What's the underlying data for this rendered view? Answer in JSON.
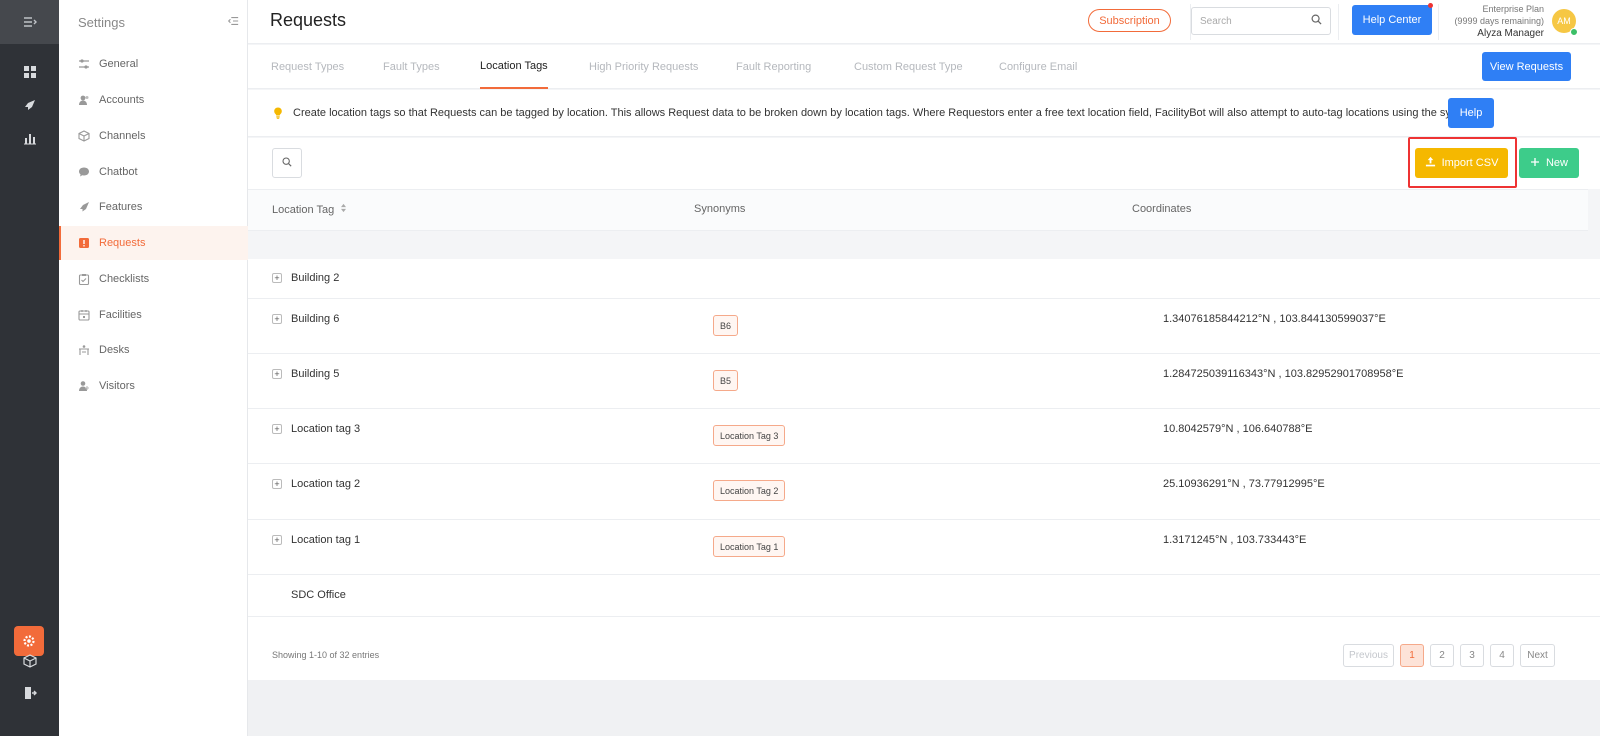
{
  "rail": {
    "items": [
      "dashboard-icon",
      "requests-rocket-icon",
      "analytics-icon",
      "settings-gear-icon",
      "cube-icon",
      "logout-icon"
    ]
  },
  "sidebar": {
    "title": "Settings",
    "items": [
      {
        "label": "General",
        "icon": "sliders-icon"
      },
      {
        "label": "Accounts",
        "icon": "users-icon"
      },
      {
        "label": "Channels",
        "icon": "cube-icon"
      },
      {
        "label": "Chatbot",
        "icon": "chat-icon"
      },
      {
        "label": "Features",
        "icon": "rocket-icon"
      },
      {
        "label": "Requests",
        "icon": "alert-box-icon",
        "active": true
      },
      {
        "label": "Checklists",
        "icon": "clipboard-icon"
      },
      {
        "label": "Facilities",
        "icon": "calendar-icon"
      },
      {
        "label": "Desks",
        "icon": "desk-icon"
      },
      {
        "label": "Visitors",
        "icon": "visitor-icon"
      }
    ]
  },
  "header": {
    "title": "Requests",
    "subscription_label": "Subscription",
    "search_placeholder": "Search",
    "help_center_label": "Help Center",
    "plan_name": "Enterprise Plan",
    "plan_remaining": "(9999 days remaining)",
    "user_name": "Alyza Manager",
    "avatar_initials": "AM"
  },
  "tabs": {
    "items": [
      {
        "label": "Request Types"
      },
      {
        "label": "Fault Types"
      },
      {
        "label": "Location Tags",
        "active": true
      },
      {
        "label": "High Priority Requests"
      },
      {
        "label": "Fault Reporting"
      },
      {
        "label": "Custom Request Type"
      },
      {
        "label": "Configure Email"
      }
    ],
    "view_requests_label": "View Requests"
  },
  "info": {
    "text": "Create location tags so that Requests can be tagged by location. This allows Request data to be broken down by location tags. Where Requestors enter a free text location field, FacilityBot will also attempt to auto-tag locations using the synonyms.",
    "help_label": "Help"
  },
  "toolbar": {
    "import_label": "Import CSV",
    "new_label": "New"
  },
  "table": {
    "columns": [
      "Location Tag",
      "Synonyms",
      "Coordinates"
    ],
    "rows": [
      {
        "name": "Building 2",
        "synonym": "",
        "coordinates": "",
        "expandable": true
      },
      {
        "name": "Building 6",
        "synonym": "B6",
        "coordinates": "1.34076185844212°N , 103.844130599037°E",
        "expandable": true
      },
      {
        "name": "Building 5",
        "synonym": "B5",
        "coordinates": "1.284725039116343°N , 103.82952901708958°E",
        "expandable": true
      },
      {
        "name": "Location tag 3",
        "synonym": "Location Tag 3",
        "coordinates": "10.8042579°N , 106.640788°E",
        "expandable": true
      },
      {
        "name": "Location tag 2",
        "synonym": "Location Tag 2",
        "coordinates": "25.10936291°N , 73.77912995°E",
        "expandable": true
      },
      {
        "name": "Location tag 1",
        "synonym": "Location Tag 1",
        "coordinates": "1.3171245°N , 103.733443°E",
        "expandable": true
      },
      {
        "name": "SDC Office",
        "synonym": "",
        "coordinates": "",
        "expandable": false
      }
    ],
    "entries_text": "Showing 1-10 of 32 entries",
    "pagination": {
      "previous": "Previous",
      "pages": [
        "1",
        "2",
        "3",
        "4"
      ],
      "current": "1",
      "next": "Next"
    }
  },
  "colors": {
    "accent": "#f26b3a",
    "primary_blue": "#2f7ff5",
    "import_yellow": "#f5b800",
    "new_green": "#3dcc8a",
    "highlight_red": "#e33333"
  }
}
